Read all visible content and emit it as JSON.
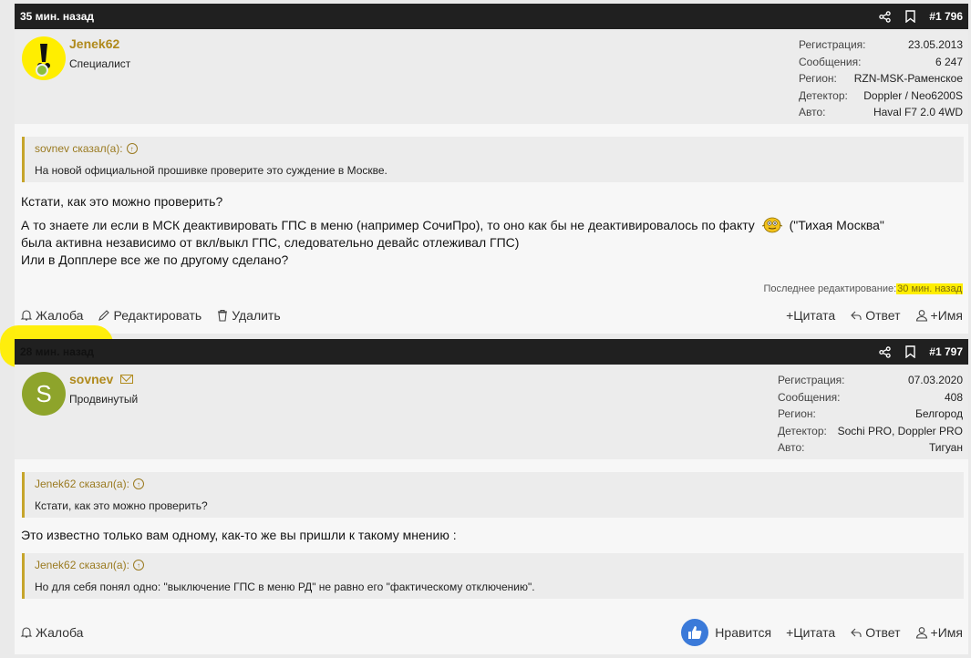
{
  "colors": {
    "header_bg": "#202020",
    "username": "#b08a1c",
    "highlight": "#ffee00",
    "like": "#3b7ad9"
  },
  "post1": {
    "time": "35 мин. назад",
    "number": "#1 796",
    "username": "Jenek62",
    "role": "Специалист",
    "stats": [
      {
        "k": "Регистрация:",
        "v": "23.05.2013"
      },
      {
        "k": "Сообщения:",
        "v": "6 247"
      },
      {
        "k": "Регион:",
        "v": "RZN-MSK-Раменское"
      },
      {
        "k": "Детектор:",
        "v": "Doppler / Neo6200S"
      },
      {
        "k": "Авто:",
        "v": "Haval F7 2.0 4WD"
      }
    ],
    "quote_author": "sovnev сказал(а):",
    "quote_text": "На новой официальной прошивке проверите это суждение в Москве.",
    "msg_line1": "Кстати, как это можно проверить?",
    "msg_line2a": "А то знаете ли если в МСК деактивировать ГПС в меню (например СочиПро), то оно как бы не деактивировалось по факту",
    "msg_line2b": "(\"Тихая Москва\"",
    "msg_line3": "была активна независимо от вкл/выкл ГПС, следовательно девайс отлеживал ГПС)",
    "msg_line4": "Или в Допплере все же по другому сделано?",
    "edited_label": "Последнее редактирование:",
    "edited_time": "30 мин. назад",
    "actions_left": [
      "Жалоба",
      "Редактировать",
      "Удалить"
    ],
    "actions_right": [
      "+Цитата",
      "Ответ",
      "+Имя"
    ]
  },
  "post2": {
    "time": "28 мин. назад",
    "number": "#1 797",
    "username": "sovnev",
    "avatar_letter": "S",
    "role": "Продвинутый",
    "stats": [
      {
        "k": "Регистрация:",
        "v": "07.03.2020"
      },
      {
        "k": "Сообщения:",
        "v": "408"
      },
      {
        "k": "Регион:",
        "v": "Белгород"
      },
      {
        "k": "Детектор:",
        "v": "Sochi PRO, Doppler PRO"
      },
      {
        "k": "Авто:",
        "v": "Тигуан"
      }
    ],
    "quote1_author": "Jenek62 сказал(а):",
    "quote1_text": "Кстати, как это можно проверить?",
    "msg": "Это известно только вам одному, как-то же вы пришли к такому мнению :",
    "quote2_author": "Jenek62 сказал(а):",
    "quote2_text": "Но для себя понял одно: \"выключение ГПС в меню РД\" не равно его \"фактическому отключению\".",
    "action_report": "Жалоба",
    "action_like": "Нравится",
    "actions_right": [
      "+Цитата",
      "Ответ",
      "+Имя"
    ]
  }
}
